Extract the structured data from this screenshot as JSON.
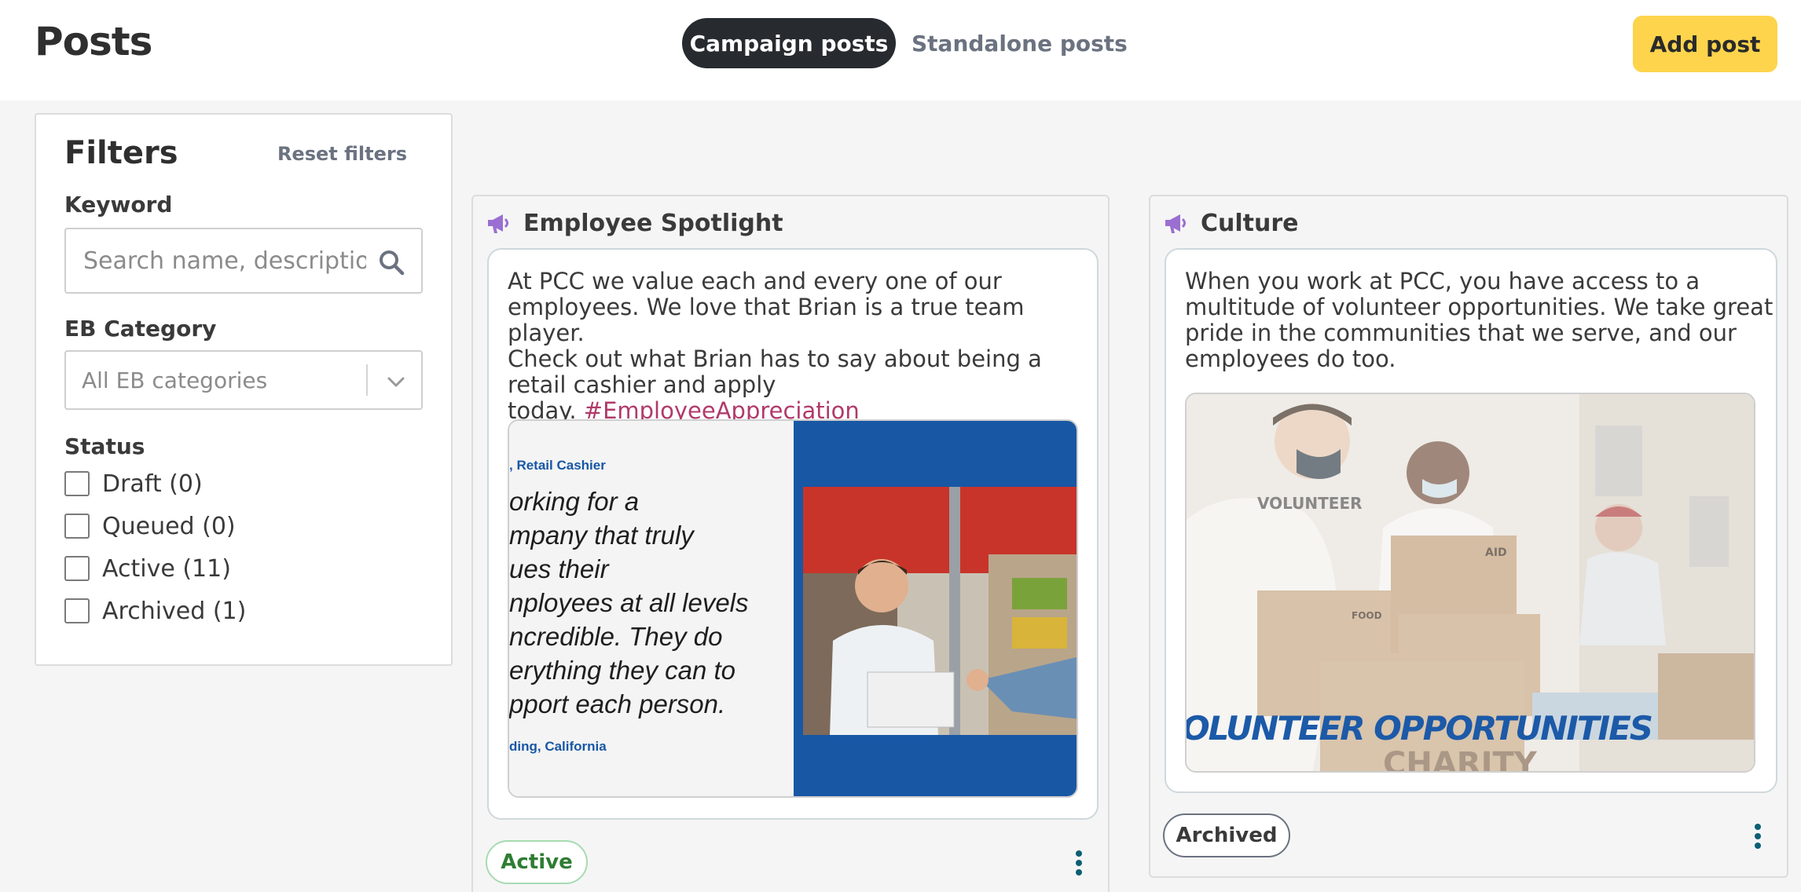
{
  "header": {
    "title": "Posts",
    "tabs": [
      {
        "label": "Campaign posts",
        "active": true
      },
      {
        "label": "Standalone posts",
        "active": false
      }
    ],
    "add_button": "Add post"
  },
  "filters": {
    "title": "Filters",
    "reset_label": "Reset filters",
    "keyword": {
      "label": "Keyword",
      "placeholder": "Search name, description",
      "icon": "search-icon"
    },
    "eb_category": {
      "label": "EB Category",
      "value": "All EB categories",
      "icon": "chevron-down-icon"
    },
    "status": {
      "label": "Status",
      "options": [
        {
          "label": "Draft (0)",
          "checked": false
        },
        {
          "label": "Queued (0)",
          "checked": false
        },
        {
          "label": "Active (11)",
          "checked": false
        },
        {
          "label": "Archived (1)",
          "checked": false
        }
      ]
    }
  },
  "posts": [
    {
      "category": "Employee Spotlight",
      "icon": "megaphone-icon",
      "text_lines": [
        "At PCC we value each and every one of our",
        "employees. We love that Brian is a true team player.",
        "Check out what Brian has to say about being a",
        "retail cashier and apply",
        "today."
      ],
      "hashtag": "#EmployeeAppreciation",
      "image": {
        "caption_top": ", Retail Cashier",
        "quote_lines": [
          "orking for a",
          "mpany that truly",
          "ues their",
          "nployees at all levels",
          "ncredible. They do",
          "erything they can to",
          "pport each person."
        ],
        "caption_bottom": "ding, California"
      },
      "status": "Active"
    },
    {
      "category": "Culture",
      "icon": "megaphone-icon",
      "text_lines": [
        "When you work at PCC, you have access to a",
        "multitude of volunteer opportunities. We take great",
        "pride in the communities that we serve, and our",
        "employees do too."
      ],
      "image": {
        "overlay_text": "OLUNTEER OPPORTUNITIES",
        "shirt_text": "VOLUNTEER",
        "box_text_1": "AID",
        "box_text_2": "FOOD",
        "box_text_3": "CHARITY"
      },
      "status": "Archived"
    }
  ],
  "colors": {
    "accent_yellow": "#fdd44c",
    "tab_dark": "#272b2f",
    "megaphone": "#9b6fd1",
    "hashtag": "#b03a6a",
    "active_green": "#2e7d32",
    "kebab": "#0b5f73"
  }
}
